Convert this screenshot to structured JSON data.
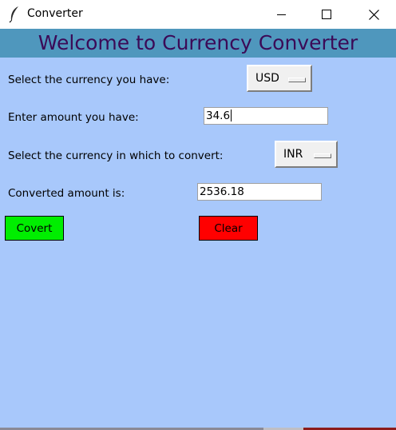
{
  "window": {
    "title": "Converter",
    "icon": "feather-icon"
  },
  "header": {
    "title": "Welcome to Currency Converter",
    "text_color": "#3b0a57",
    "background": "#4f97bd"
  },
  "form": {
    "from_label": "Select the currency you have:",
    "from_currency": "USD",
    "amount_label": "Enter amount you have:",
    "amount_value": "34.6",
    "to_label": "Select the currency in which to convert:",
    "to_currency": "INR",
    "result_label": "Converted amount is:",
    "result_value": "2536.18",
    "background": "#a8c8fb"
  },
  "buttons": {
    "convert_label": "Covert",
    "convert_color": "#00ee00",
    "clear_label": "Clear",
    "clear_color": "#ff0000"
  }
}
